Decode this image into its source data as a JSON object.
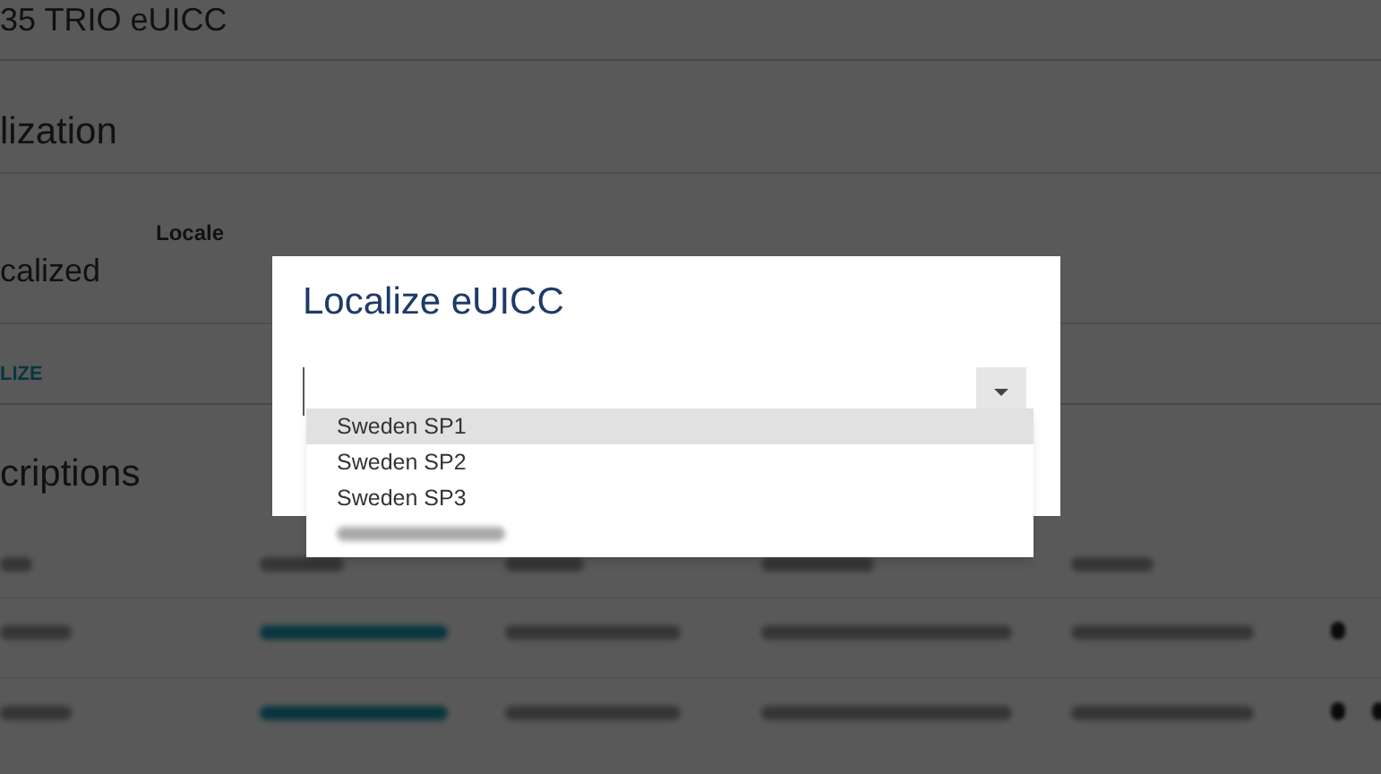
{
  "page": {
    "title": "35 TRIO eUICC",
    "localization": {
      "heading": "lization",
      "locale_label": "Locale",
      "status": "calized",
      "action": "LIZE"
    },
    "subscriptions": {
      "heading": "criptions"
    }
  },
  "dialog": {
    "title": "Localize eUICC",
    "select": {
      "expanded": true,
      "options": [
        {
          "label": "Sweden SP1",
          "selected": true
        },
        {
          "label": "Sweden SP2",
          "selected": false
        },
        {
          "label": "Sweden SP3",
          "selected": false
        }
      ]
    }
  }
}
